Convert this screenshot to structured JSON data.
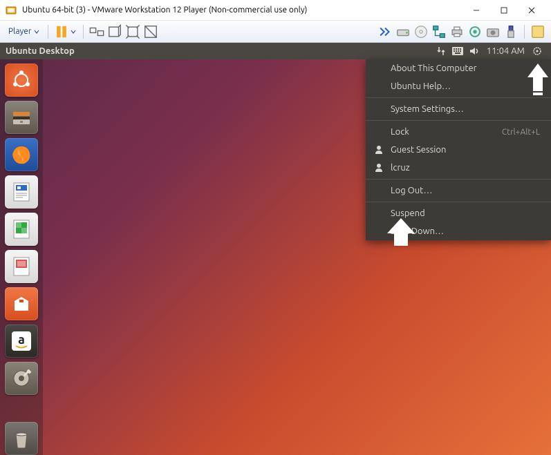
{
  "window": {
    "title": "Ubuntu 64-bit (3) - VMware Workstation 12 Player (Non-commercial use only)"
  },
  "vm_toolbar": {
    "player_label": "Player"
  },
  "ubuntu": {
    "bar_title": "Ubuntu Desktop",
    "time": "11:04 AM"
  },
  "sys_menu": {
    "about": "About This Computer",
    "help": "Ubuntu Help…",
    "settings": "System Settings…",
    "lock": "Lock",
    "lock_shortcut": "Ctrl+Alt+L",
    "guest": "Guest Session",
    "user": "lcruz",
    "logout": "Log Out…",
    "suspend": "Suspend",
    "shutdown": "Shut Down…"
  }
}
